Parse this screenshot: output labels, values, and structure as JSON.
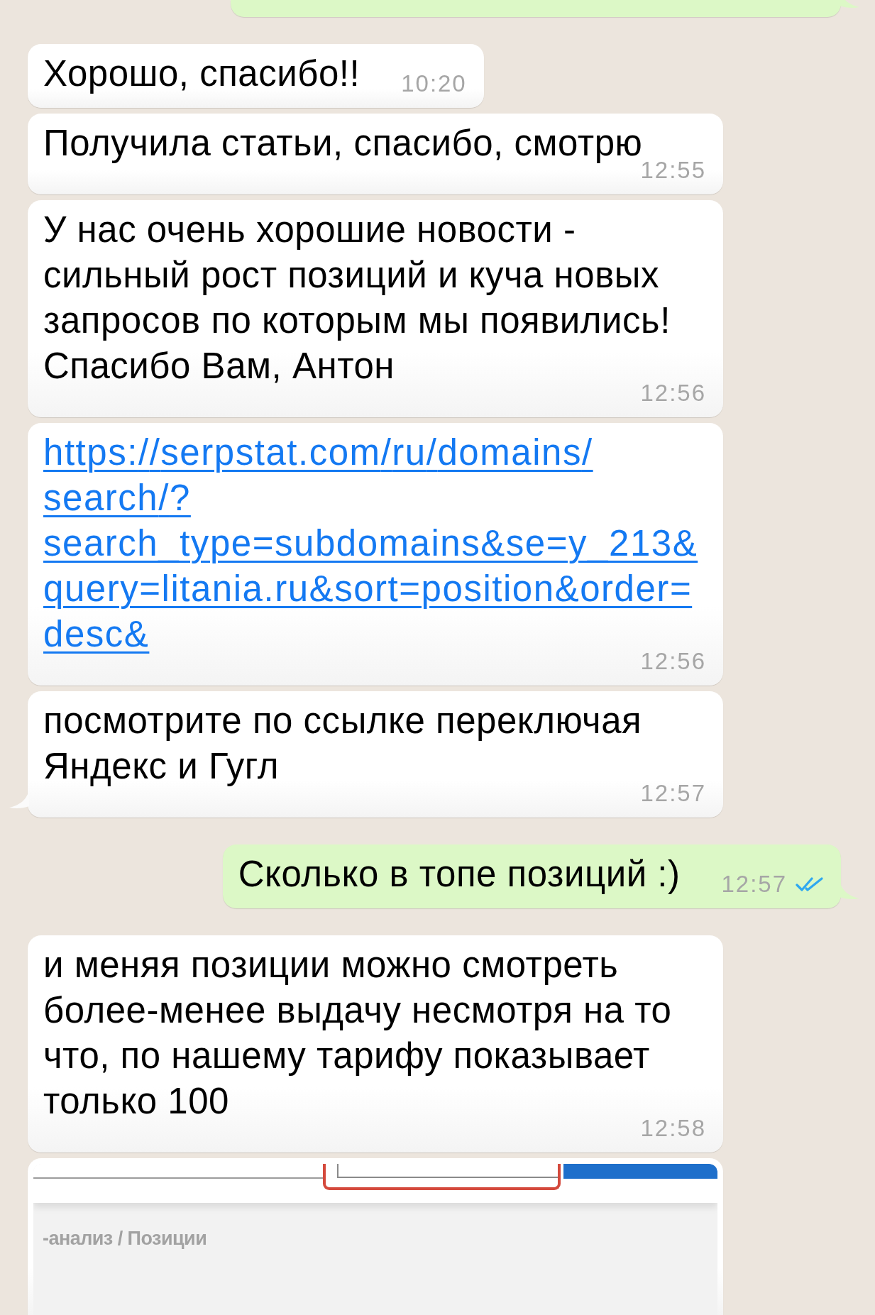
{
  "chat": {
    "messages": [
      {
        "outgoing": true,
        "kind": "cut_off",
        "tail": true
      },
      {
        "outgoing": false,
        "kind": "text",
        "text": "Хорошо, спасибо!!",
        "time": "10:20",
        "tail": false
      },
      {
        "outgoing": false,
        "kind": "text",
        "text": "Получила статьи, спасибо, смотрю",
        "time": "12:55",
        "tail": false
      },
      {
        "outgoing": false,
        "kind": "text",
        "text": "У нас очень хорошие новости - сильный рост позиций и куча новых запросов по которым мы появились! Спасибо Вам, Антон",
        "time": "12:56",
        "tail": false
      },
      {
        "outgoing": false,
        "kind": "link",
        "text": "https://serpstat.com/ru/domains/search/?search_type=subdomains&se=y_213&query=litania.ru&sort=position&order=desc&",
        "time": "12:56",
        "tail": false
      },
      {
        "outgoing": false,
        "kind": "text",
        "text": "посмотрите по ссылке переключая Яндекс и Гугл",
        "time": "12:57",
        "tail": true
      },
      {
        "outgoing": true,
        "kind": "text",
        "text": "Сколько в топе позиций :)",
        "time": "12:57",
        "read": true,
        "tail": true
      },
      {
        "outgoing": false,
        "kind": "text",
        "text": "и меняя позиции можно смотреть более-менее выдачу несмотря на то что, по нашему тарифу показывает только 100",
        "time": "12:58",
        "tail": false
      },
      {
        "outgoing": false,
        "kind": "image",
        "screenshot": {
          "breadcrumb": "-анализ / Позиции"
        },
        "tail": false
      }
    ]
  }
}
